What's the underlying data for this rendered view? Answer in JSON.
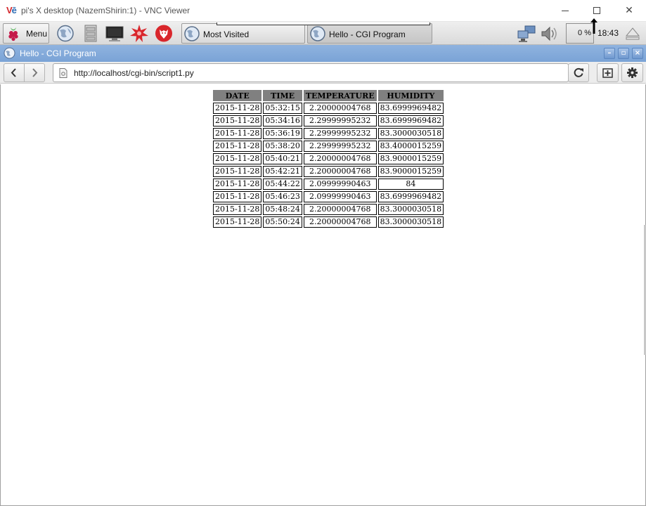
{
  "vnc": {
    "title": "pi's X desktop (NazemShirin:1) - VNC Viewer"
  },
  "taskbar": {
    "menu_label": "Menu",
    "tasks": [
      {
        "label": "Most Visited"
      },
      {
        "label": "Hello - CGI Program"
      }
    ],
    "cpu": "0 %",
    "clock": "18:43"
  },
  "window": {
    "title": "Hello - CGI Program"
  },
  "toolbar": {
    "url": "http://localhost/cgi-bin/script1.py"
  },
  "table": {
    "headers": [
      "DATE",
      "TIME",
      "TEMPERATURE",
      "HUMIDITY"
    ],
    "rows": [
      [
        "2015-11-28",
        "05:32:15",
        "2.20000004768",
        "83.6999969482"
      ],
      [
        "2015-11-28",
        "05:34:16",
        "2.29999995232",
        "83.6999969482"
      ],
      [
        "2015-11-28",
        "05:36:19",
        "2.29999995232",
        "83.3000030518"
      ],
      [
        "2015-11-28",
        "05:38:20",
        "2.29999995232",
        "83.4000015259"
      ],
      [
        "2015-11-28",
        "05:40:21",
        "2.20000004768",
        "83.9000015259"
      ],
      [
        "2015-11-28",
        "05:42:21",
        "2.20000004768",
        "83.9000015259"
      ],
      [
        "2015-11-28",
        "05:44:22",
        "2.09999990463",
        "84"
      ],
      [
        "2015-11-28",
        "05:46:23",
        "2.09999990463",
        "83.6999969482"
      ],
      [
        "2015-11-28",
        "05:48:24",
        "2.20000004768",
        "83.3000030518"
      ],
      [
        "2015-11-28",
        "05:50:24",
        "2.20000004768",
        "83.3000030518"
      ]
    ]
  },
  "colors": {
    "window_titlebar": "#7aa3d6",
    "table_header": "#808080",
    "vnc_logo_red": "#d4262b",
    "vnc_logo_blue": "#2d6db5"
  },
  "icons": {
    "menu": "raspberry-icon",
    "browser": "globe-icon",
    "files": "file-cabinet-icon",
    "terminal": "monitor-icon",
    "math": "starburst-icon",
    "wolfram": "wolf-icon",
    "network": "network-icon",
    "volume": "speaker-icon",
    "eject": "eject-icon"
  }
}
